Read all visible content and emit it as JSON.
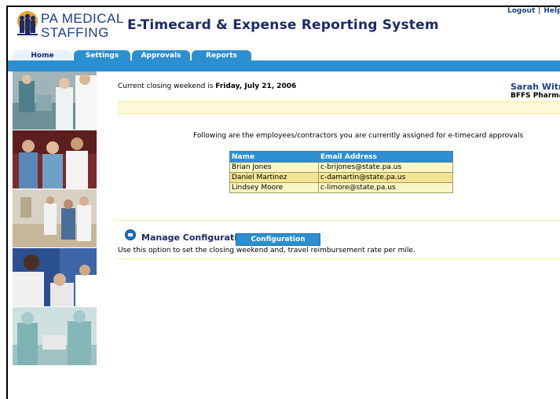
{
  "header": {
    "logo_line1": "PA MEDICAL",
    "logo_line2": "STAFFING",
    "app_title": "E-Timecard & Expense Reporting System",
    "logout": "Logout",
    "separator": "|",
    "help": "Help"
  },
  "tabs": [
    {
      "label": "Home",
      "active": true
    },
    {
      "label": "Settings",
      "active": false
    },
    {
      "label": "Approvals",
      "active": false
    },
    {
      "label": "Reports",
      "active": false
    }
  ],
  "colors": {
    "accent": "#2c8fd0",
    "title": "#1b2a6b",
    "row_light": "#fbf7c4",
    "row_dark": "#f4e493"
  },
  "main": {
    "closing_prefix": "Current closing weekend is",
    "closing_date": "Friday, July 21, 2006",
    "user_name": "Sarah Witmer",
    "user_dept": "BFFS Pharmacy",
    "intro": "Following are the employees/contractors you are currently assigned for e-timecard approvals",
    "table": {
      "headers": [
        "Name",
        "Email Address"
      ],
      "rows": [
        [
          "Brian Jones",
          "c-brijones@state.pa.us"
        ],
        [
          "Daniel Martinez",
          "c-damartin@state.pa.us"
        ],
        [
          "Lindsey Moore",
          "c-limore@state.pa.us"
        ]
      ]
    },
    "manage_label": "Manage Configuration:",
    "config_button": "Configuration",
    "manage_desc": "Use this option to set the closing weekend and, travel reimbursement rate per mile."
  },
  "photos": [
    "surgery-team-photo",
    "medical-staff-photo",
    "hospital-room-photo",
    "doctor-patient-photo",
    "operating-room-photo"
  ]
}
